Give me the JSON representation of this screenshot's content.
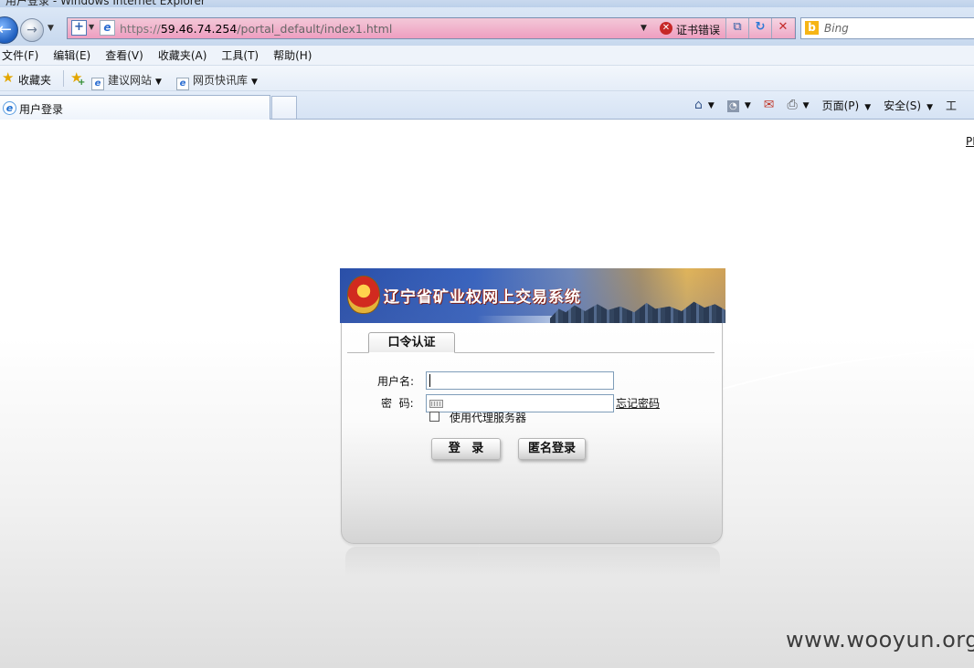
{
  "window": {
    "title": "用户登录 - Windows Internet Explorer"
  },
  "address_bar": {
    "url_protocol": "https://",
    "url_host": "59.46.74.254",
    "url_path": "/portal_default/index1.html",
    "cert_error": "证书错误"
  },
  "search": {
    "placeholder": "Bing"
  },
  "menu": {
    "items": [
      "文件(F)",
      "编辑(E)",
      "查看(V)",
      "收藏夹(A)",
      "工具(T)",
      "帮助(H)"
    ]
  },
  "favorites_bar": {
    "label": "收藏夹",
    "links": [
      "建议网站",
      "网页快讯库"
    ]
  },
  "tabs": {
    "active_title": "用户登录"
  },
  "command_bar": {
    "page": "页面(P)",
    "safety": "安全(S)",
    "tools_truncated": "工"
  },
  "page": {
    "corner_text": "PI",
    "banner_title": "辽宁省矿业权网上交易系统",
    "login_tab": "口令认证",
    "username_label": "用户名:",
    "password_label": "密  码:",
    "username_value": "",
    "password_value": "",
    "forgot_password": "忘记密码",
    "use_proxy": "使用代理服务器",
    "proxy_checked": false,
    "login_button": "登 录",
    "anonymous_button": "匿名登录"
  },
  "watermark": "www.wooyun.org",
  "colors": {
    "address_error_bg": "#ee9ec0",
    "ie_chrome": "#dbe7f6",
    "banner_blue": "#2a4fa8"
  }
}
